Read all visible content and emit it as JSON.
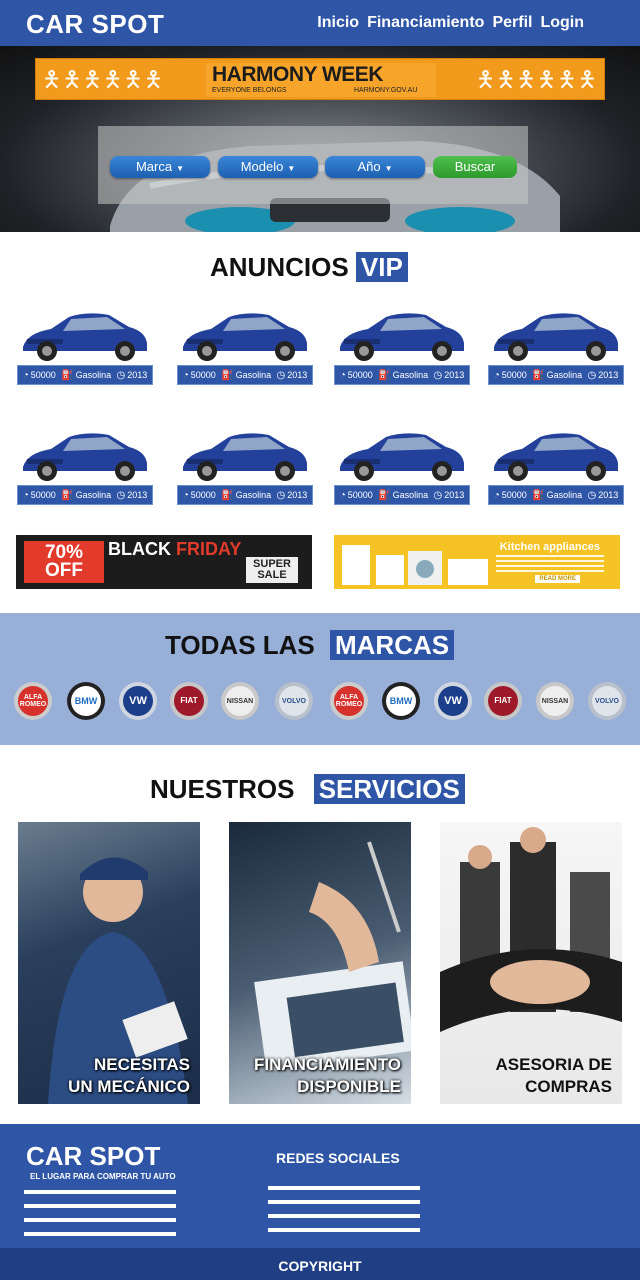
{
  "header": {
    "brand": "CAR SPOT",
    "nav": [
      "Inicio",
      "Financiamiento",
      "Perfil",
      "Login"
    ]
  },
  "banner": {
    "title": "HARMONY WEEK",
    "tagline": "EVERYONE BELONGS",
    "url": "HARMONY.GOV.AU"
  },
  "search": {
    "filters": [
      "Marca",
      "Modelo",
      "Año"
    ],
    "button": "Buscar"
  },
  "vip": {
    "title_prefix": "ANUNCIOS",
    "title_highlight": "VIP",
    "listings": [
      {
        "km": "50000",
        "fuel": "Gasolina",
        "year": "2013"
      },
      {
        "km": "50000",
        "fuel": "Gasolina",
        "year": "2013"
      },
      {
        "km": "50000",
        "fuel": "Gasolina",
        "year": "2013"
      },
      {
        "km": "50000",
        "fuel": "Gasolina",
        "year": "2013"
      },
      {
        "km": "50000",
        "fuel": "Gasolina",
        "year": "2013"
      },
      {
        "km": "50000",
        "fuel": "Gasolina",
        "year": "2013"
      },
      {
        "km": "50000",
        "fuel": "Gasolina",
        "year": "2013"
      },
      {
        "km": "50000",
        "fuel": "Gasolina",
        "year": "2013"
      }
    ]
  },
  "ads": {
    "black_friday": {
      "percent": "70%",
      "off": "OFF",
      "black": "BLACK",
      "friday": "FRIDAY",
      "super": "SUPER",
      "sale": "SALE"
    },
    "kitchen": {
      "title": "Kitchen appliances",
      "button": "READ MORE"
    }
  },
  "brands": {
    "title_prefix": "TODAS LAS",
    "title_highlight": "MARCAS",
    "logos": [
      "ALFA ROMEO",
      "BMW",
      "VW",
      "FIAT",
      "NISSAN",
      "VOLVO",
      "ALFA ROMEO",
      "BMW",
      "VW",
      "FIAT",
      "NISSAN",
      "VOLVO"
    ]
  },
  "services": {
    "title_prefix": "NUESTROS",
    "title_highlight": "SERVICIOS",
    "items": [
      {
        "line1": "NECESITAS",
        "line2": "UN MECÁNICO"
      },
      {
        "line1": "FINANCIAMIENTO",
        "line2": "DISPONIBLE"
      },
      {
        "line1": "ASESORIA DE",
        "line2": "COMPRAS"
      }
    ]
  },
  "footer": {
    "brand": "CAR SPOT",
    "tagline": "EL LUGAR PARA COMPRAR TU AUTO",
    "social_title": "REDES SOCIALES",
    "copyright": "COPYRIGHT"
  },
  "colors": {
    "primary": "#2f56a6",
    "light": "#98afd8",
    "search_green": "#2c9a2c"
  }
}
